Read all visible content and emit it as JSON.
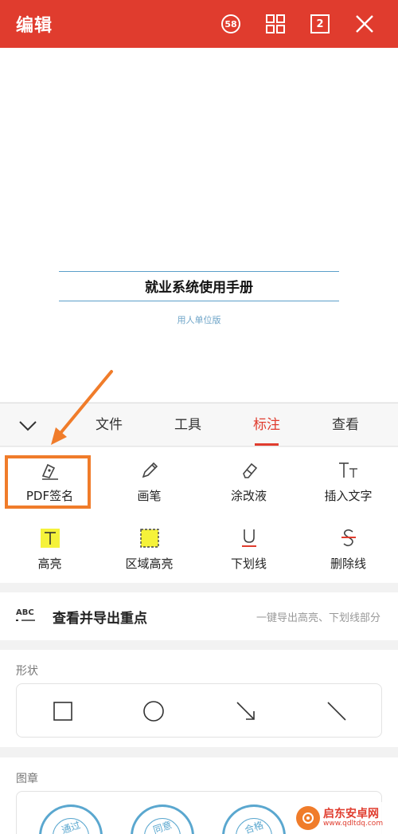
{
  "header": {
    "title": "编辑",
    "badge_count": "58",
    "page_count": "2",
    "bg_color": "#e03c2e"
  },
  "document": {
    "title": "就业系统使用手册",
    "subtitle": "用人单位版"
  },
  "tabs": [
    {
      "label": "文件",
      "active": false
    },
    {
      "label": "工具",
      "active": false
    },
    {
      "label": "标注",
      "active": true
    },
    {
      "label": "查看",
      "active": false
    }
  ],
  "tools": [
    {
      "label": "PDF签名",
      "icon": "pen-nib-icon"
    },
    {
      "label": "画笔",
      "icon": "pencil-icon"
    },
    {
      "label": "涂改液",
      "icon": "eraser-icon"
    },
    {
      "label": "插入文字",
      "icon": "text-insert-icon"
    },
    {
      "label": "高亮",
      "icon": "highlight-icon"
    },
    {
      "label": "区域高亮",
      "icon": "area-highlight-icon"
    },
    {
      "label": "下划线",
      "icon": "underline-icon"
    },
    {
      "label": "删除线",
      "icon": "strikethrough-icon"
    }
  ],
  "export": {
    "icon_text": "ABC",
    "label": "查看并导出重点",
    "hint": "一键导出高亮、下划线部分"
  },
  "shapes": {
    "title": "形状",
    "items": [
      "square-icon",
      "circle-icon",
      "arrow-icon",
      "line-icon"
    ]
  },
  "stamps": {
    "title": "图章",
    "items": [
      {
        "label": "通过"
      },
      {
        "label": "同意"
      },
      {
        "label": "合格"
      }
    ]
  },
  "watermark": {
    "name": "启东安卓网",
    "url": "www.qdltdq.com"
  },
  "accent_color": "#e03c2e",
  "highlight_color": "#f07c2a"
}
